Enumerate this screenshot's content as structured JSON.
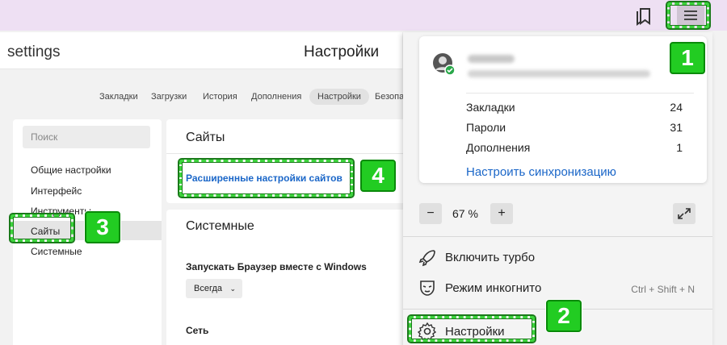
{
  "browser": {
    "address": "settings",
    "page_title": "Настройки"
  },
  "tabs": [
    "Закладки",
    "Загрузки",
    "История",
    "Дополнения",
    "Настройки",
    "Безопа"
  ],
  "sidebar": {
    "search_placeholder": "Поиск",
    "items": [
      "Общие настройки",
      "Интерфейс",
      "Инструменты",
      "Сайты",
      "Системные"
    ]
  },
  "sites_panel": {
    "title": "Сайты",
    "link": "Расширенные настройки сайтов"
  },
  "system_panel": {
    "title": "Системные",
    "autostart_label": "Запускать Браузер вместе с Windows",
    "autostart_value": "Всегда",
    "network_label": "Сеть"
  },
  "menu": {
    "stats": [
      {
        "label": "Закладки",
        "value": "24"
      },
      {
        "label": "Пароли",
        "value": "31"
      },
      {
        "label": "Дополнения",
        "value": "1"
      }
    ],
    "sync_link": "Настроить синхронизацию",
    "zoom": {
      "minus": "−",
      "value": "67 %",
      "plus": "+"
    },
    "items": [
      {
        "label": "Включить турбо",
        "shortcut": "",
        "icon": "rocket-icon"
      },
      {
        "label": "Режим инкогнито",
        "shortcut": "Ctrl + Shift + N",
        "icon": "incognito-mask-icon"
      },
      {
        "label": "Настройки",
        "shortcut": "",
        "icon": "gear-icon"
      }
    ]
  },
  "annotations": [
    "1",
    "2",
    "3",
    "4"
  ],
  "colors": {
    "highlight": "#3cd43c",
    "badge": "#22cc22",
    "link": "#1a66c8",
    "topbar": "#eee0f3"
  }
}
